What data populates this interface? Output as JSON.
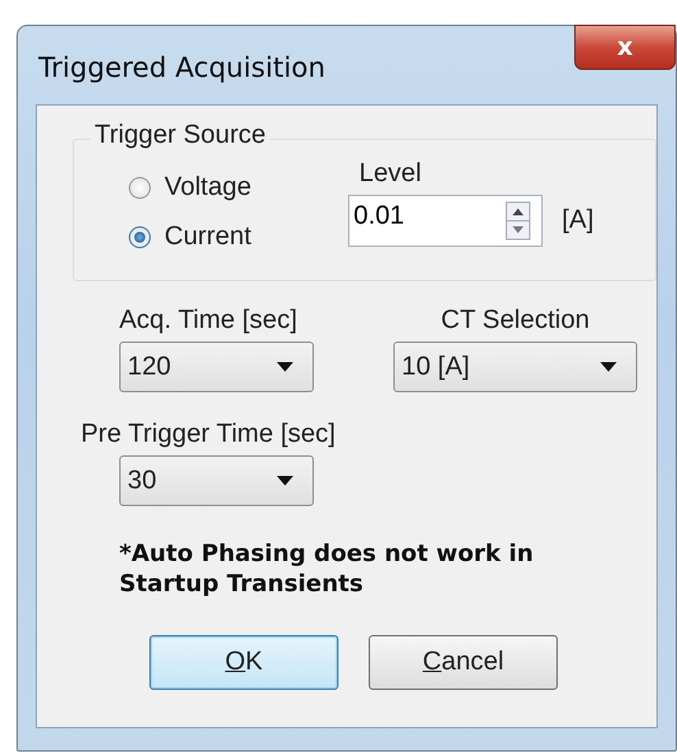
{
  "window": {
    "title": "Triggered Acquisition",
    "close": "x"
  },
  "trigger_source": {
    "title": "Trigger Source",
    "options": [
      {
        "label": "Voltage",
        "selected": false
      },
      {
        "label": "Current",
        "selected": true
      }
    ],
    "level": {
      "label": "Level",
      "value": "0.01",
      "unit": "[A]"
    }
  },
  "acq_time": {
    "label": "Acq. Time [sec]",
    "value": "120"
  },
  "ct_selection": {
    "label": "CT Selection",
    "value": "10 [A]"
  },
  "pre_trigger": {
    "label": "Pre Trigger Time [sec]",
    "value": "30"
  },
  "note": "*Auto Phasing does not work in Startup Transients",
  "buttons": [
    {
      "label": "OK",
      "kind": "default"
    },
    {
      "label": "Cancel",
      "kind": "normal"
    }
  ]
}
